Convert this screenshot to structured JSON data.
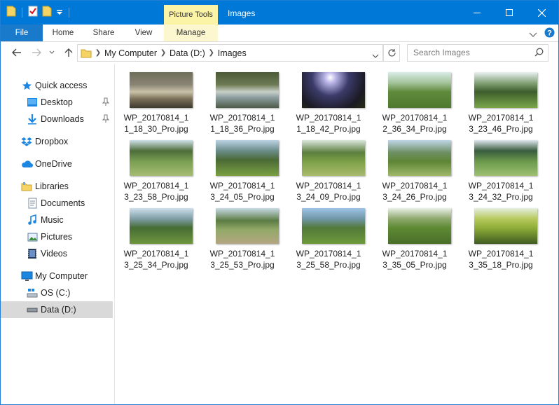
{
  "window": {
    "title": "Images",
    "context_tab": "Picture Tools",
    "accent_color": "#0078d7"
  },
  "ribbon": {
    "tabs": [
      "File",
      "Home",
      "Share",
      "View",
      "Manage"
    ]
  },
  "address": {
    "crumbs": [
      "My Computer",
      "Data (D:)",
      "Images"
    ],
    "search_placeholder": "Search Images"
  },
  "nav": {
    "items": [
      {
        "label": "Quick access",
        "icon": "star-icon"
      },
      {
        "label": "Desktop",
        "icon": "desktop-icon",
        "pinned": true
      },
      {
        "label": "Downloads",
        "icon": "download-icon",
        "pinned": true
      },
      {
        "label": "Dropbox",
        "icon": "dropbox-icon"
      },
      {
        "label": "OneDrive",
        "icon": "cloud-icon"
      },
      {
        "label": "Libraries",
        "icon": "libraries-icon"
      },
      {
        "label": "Documents",
        "icon": "document-icon"
      },
      {
        "label": "Music",
        "icon": "music-icon"
      },
      {
        "label": "Pictures",
        "icon": "picture-icon"
      },
      {
        "label": "Videos",
        "icon": "video-icon"
      },
      {
        "label": "My Computer",
        "icon": "computer-icon"
      },
      {
        "label": "OS (C:)",
        "icon": "drive-icon"
      },
      {
        "label": "Data (D:)",
        "icon": "drive-icon",
        "selected": true
      }
    ]
  },
  "files": [
    {
      "line1": "WP_20170814_1",
      "line2": "1_18_30_Pro.jpg"
    },
    {
      "line1": "WP_20170814_1",
      "line2": "1_18_36_Pro.jpg"
    },
    {
      "line1": "WP_20170814_1",
      "line2": "1_18_42_Pro.jpg"
    },
    {
      "line1": "WP_20170814_1",
      "line2": "2_36_34_Pro.jpg"
    },
    {
      "line1": "WP_20170814_1",
      "line2": "3_23_46_Pro.jpg"
    },
    {
      "line1": "WP_20170814_1",
      "line2": "3_23_58_Pro.jpg"
    },
    {
      "line1": "WP_20170814_1",
      "line2": "3_24_05_Pro.jpg"
    },
    {
      "line1": "WP_20170814_1",
      "line2": "3_24_09_Pro.jpg"
    },
    {
      "line1": "WP_20170814_1",
      "line2": "3_24_26_Pro.jpg"
    },
    {
      "line1": "WP_20170814_1",
      "line2": "3_24_32_Pro.jpg"
    },
    {
      "line1": "WP_20170814_1",
      "line2": "3_25_34_Pro.jpg"
    },
    {
      "line1": "WP_20170814_1",
      "line2": "3_25_53_Pro.jpg"
    },
    {
      "line1": "WP_20170814_1",
      "line2": "3_25_58_Pro.jpg"
    },
    {
      "line1": "WP_20170814_1",
      "line2": "3_35_05_Pro.jpg"
    },
    {
      "line1": "WP_20170814_1",
      "line2": "3_35_18_Pro.jpg"
    }
  ]
}
